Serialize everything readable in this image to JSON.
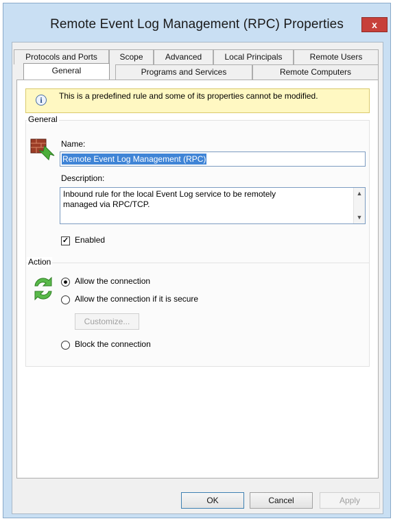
{
  "window": {
    "title": "Remote Event Log Management (RPC) Properties",
    "close_label": "x"
  },
  "tabs_row1": [
    "Protocols and Ports",
    "Scope",
    "Advanced",
    "Local Principals",
    "Remote Users"
  ],
  "tabs_row2": [
    "General",
    "Programs and Services",
    "Remote Computers"
  ],
  "info": {
    "text": "This is a predefined rule and some of its properties cannot be modified."
  },
  "general": {
    "group_label": "General",
    "name_label": "Name:",
    "name_value": "Remote Event Log Management (RPC)",
    "description_label": "Description:",
    "description_value": "Inbound rule for the local Event Log service to be remotely managed via RPC/TCP.",
    "enabled_label": "Enabled",
    "enabled": true
  },
  "action": {
    "group_label": "Action",
    "options": [
      "Allow the connection",
      "Allow the connection if it is secure",
      "Block the connection"
    ],
    "selected": "Allow the connection",
    "customize_label": "Customize..."
  },
  "footer": {
    "ok_label": "OK",
    "cancel_label": "Cancel",
    "apply_label": "Apply"
  },
  "icons": {
    "rule_icon": "firewall-rule-icon",
    "action_icon": "allow-connection-icon",
    "info_icon": "info-icon"
  }
}
